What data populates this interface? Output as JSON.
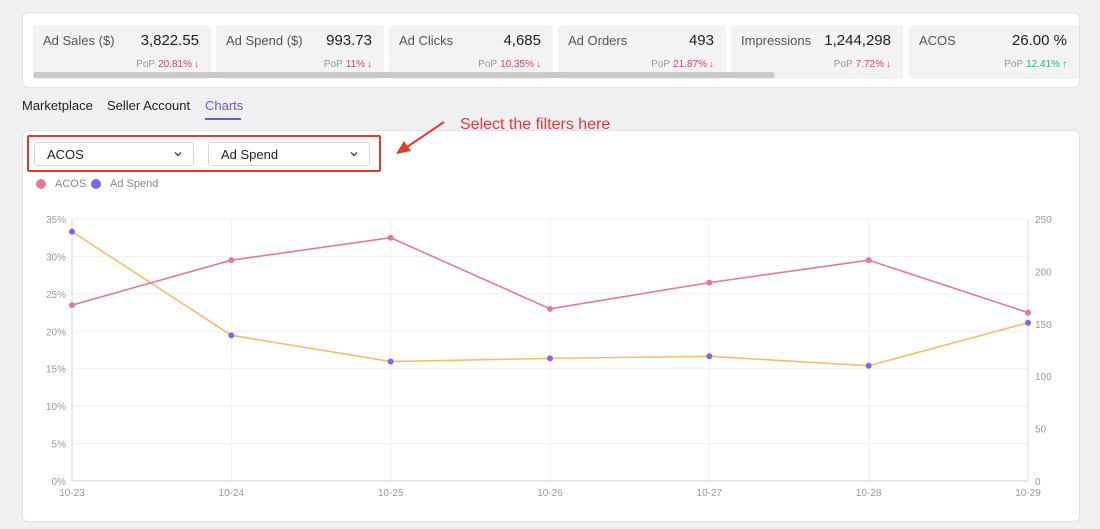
{
  "kpis": [
    {
      "label": "Ad Sales ($)",
      "value": "3,822.55",
      "pop_label": "PoP",
      "pop": "20.81%",
      "dir": "down"
    },
    {
      "label": "Ad Spend ($)",
      "value": "993.73",
      "pop_label": "PoP",
      "pop": "11%",
      "dir": "down"
    },
    {
      "label": "Ad Clicks",
      "value": "4,685",
      "pop_label": "PoP",
      "pop": "10.35%",
      "dir": "down"
    },
    {
      "label": "Ad Orders",
      "value": "493",
      "pop_label": "PoP",
      "pop": "21.87%",
      "dir": "down"
    },
    {
      "label": "Impressions",
      "value": "1,244,298",
      "pop_label": "PoP",
      "pop": "7.72%",
      "dir": "down"
    },
    {
      "label": "ACOS",
      "value": "26.00 %",
      "pop_label": "PoP",
      "pop": "12.41%",
      "dir": "up"
    }
  ],
  "tabs": [
    {
      "label": "Marketplace",
      "active": false
    },
    {
      "label": "Seller Account",
      "active": false
    },
    {
      "label": "Charts",
      "active": true
    }
  ],
  "filters": {
    "metric1": "ACOS",
    "metric2": "Ad Spend"
  },
  "annotation": {
    "text": "Select the filters here"
  },
  "colors": {
    "accent": "#6a5acd",
    "acos": "#e07b9a",
    "ad_spend": "#7b68ee",
    "ad_spend_line": "#f2c06c",
    "down": "#e0445a",
    "up": "#2fb36a",
    "annotation": "#e23a2e"
  },
  "chart_data": {
    "type": "line",
    "x": [
      "10-23",
      "10-24",
      "10-25",
      "10-26",
      "10-27",
      "10-28",
      "10-29"
    ],
    "series": [
      {
        "name": "ACOS",
        "axis": "left",
        "values": [
          23.5,
          29.5,
          32.5,
          23.0,
          26.5,
          29.5,
          22.5
        ]
      },
      {
        "name": "Ad Spend",
        "axis": "right",
        "values": [
          238,
          139,
          114,
          117,
          119,
          110,
          151
        ]
      }
    ],
    "y_left": {
      "ticks": [
        "0%",
        "5%",
        "10%",
        "15%",
        "20%",
        "25%",
        "30%",
        "35%"
      ],
      "lim": [
        0,
        35
      ]
    },
    "y_right": {
      "ticks": [
        "0",
        "50",
        "100",
        "150",
        "200",
        "250"
      ],
      "lim": [
        0,
        250
      ]
    },
    "grid": true,
    "legend": "top-left"
  }
}
